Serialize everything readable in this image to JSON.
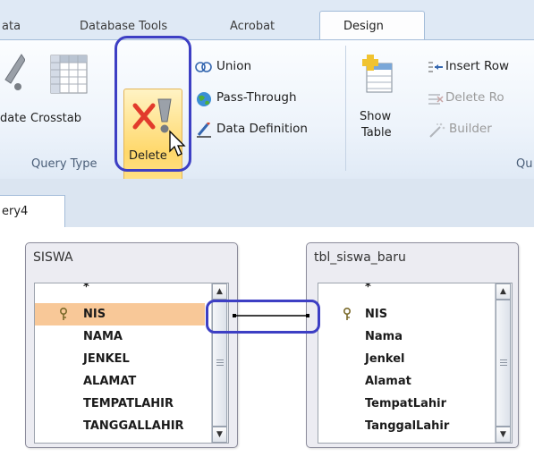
{
  "tabs": [
    {
      "label": "ata"
    },
    {
      "label": "Database Tools"
    },
    {
      "label": "Acrobat"
    },
    {
      "label": "Design"
    }
  ],
  "ribbon": {
    "query_type": {
      "buttons": {
        "update": "date",
        "crosstab": "Crosstab",
        "delete": "Delete"
      },
      "small": {
        "union": "Union",
        "pass_through": "Pass-Through",
        "data_definition": "Data Definition"
      },
      "group_label": "Query Type"
    },
    "query_setup": {
      "show_table_line1": "Show",
      "show_table_line2": "Table",
      "insert_rows": "Insert Row",
      "delete_rows": "Delete Ro",
      "builder": "Builder",
      "group_label_partial": "Qu"
    }
  },
  "query_tab": {
    "label": "ery4"
  },
  "tables": [
    {
      "title": "SISWA",
      "fields": [
        "*",
        "NIS",
        "NAMA",
        "JENKEL",
        "ALAMAT",
        "TEMPATLAHIR",
        "TANGGALLAHIR"
      ]
    },
    {
      "title": "tbl_siswa_baru",
      "fields": [
        "*",
        "NIS",
        "Nama",
        "Jenkel",
        "Alamat",
        "TempatLahir",
        "TanggalLahir"
      ]
    }
  ],
  "colors": {
    "annotation_circle": "#3d3fc4",
    "selected_field": "#f8c898",
    "delete_button": "#ffd86b"
  }
}
